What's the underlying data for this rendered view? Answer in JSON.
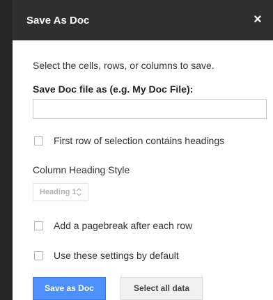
{
  "dialog": {
    "title": "Save As Doc",
    "close_label": "×"
  },
  "form": {
    "instruction": "Select the cells, rows, or columns to save.",
    "file_label": "Save Doc file as (e.g. My Doc File):",
    "file_value": "",
    "first_row_headings": {
      "label": "First row of selection contains headings",
      "checked": false
    },
    "heading_style": {
      "label": "Column Heading Style",
      "selected": "Heading 1",
      "enabled": false
    },
    "pagebreak": {
      "label": "Add a pagebreak after each row",
      "checked": false
    },
    "default_settings": {
      "label": "Use these settings by default",
      "checked": false
    }
  },
  "buttons": {
    "save_label": "Save as Doc",
    "select_all_label": "Select all data"
  },
  "colors": {
    "titlebar": "#2f2f2f",
    "primary_button": "#4d90fe",
    "secondary_button": "#f1f1f1"
  }
}
